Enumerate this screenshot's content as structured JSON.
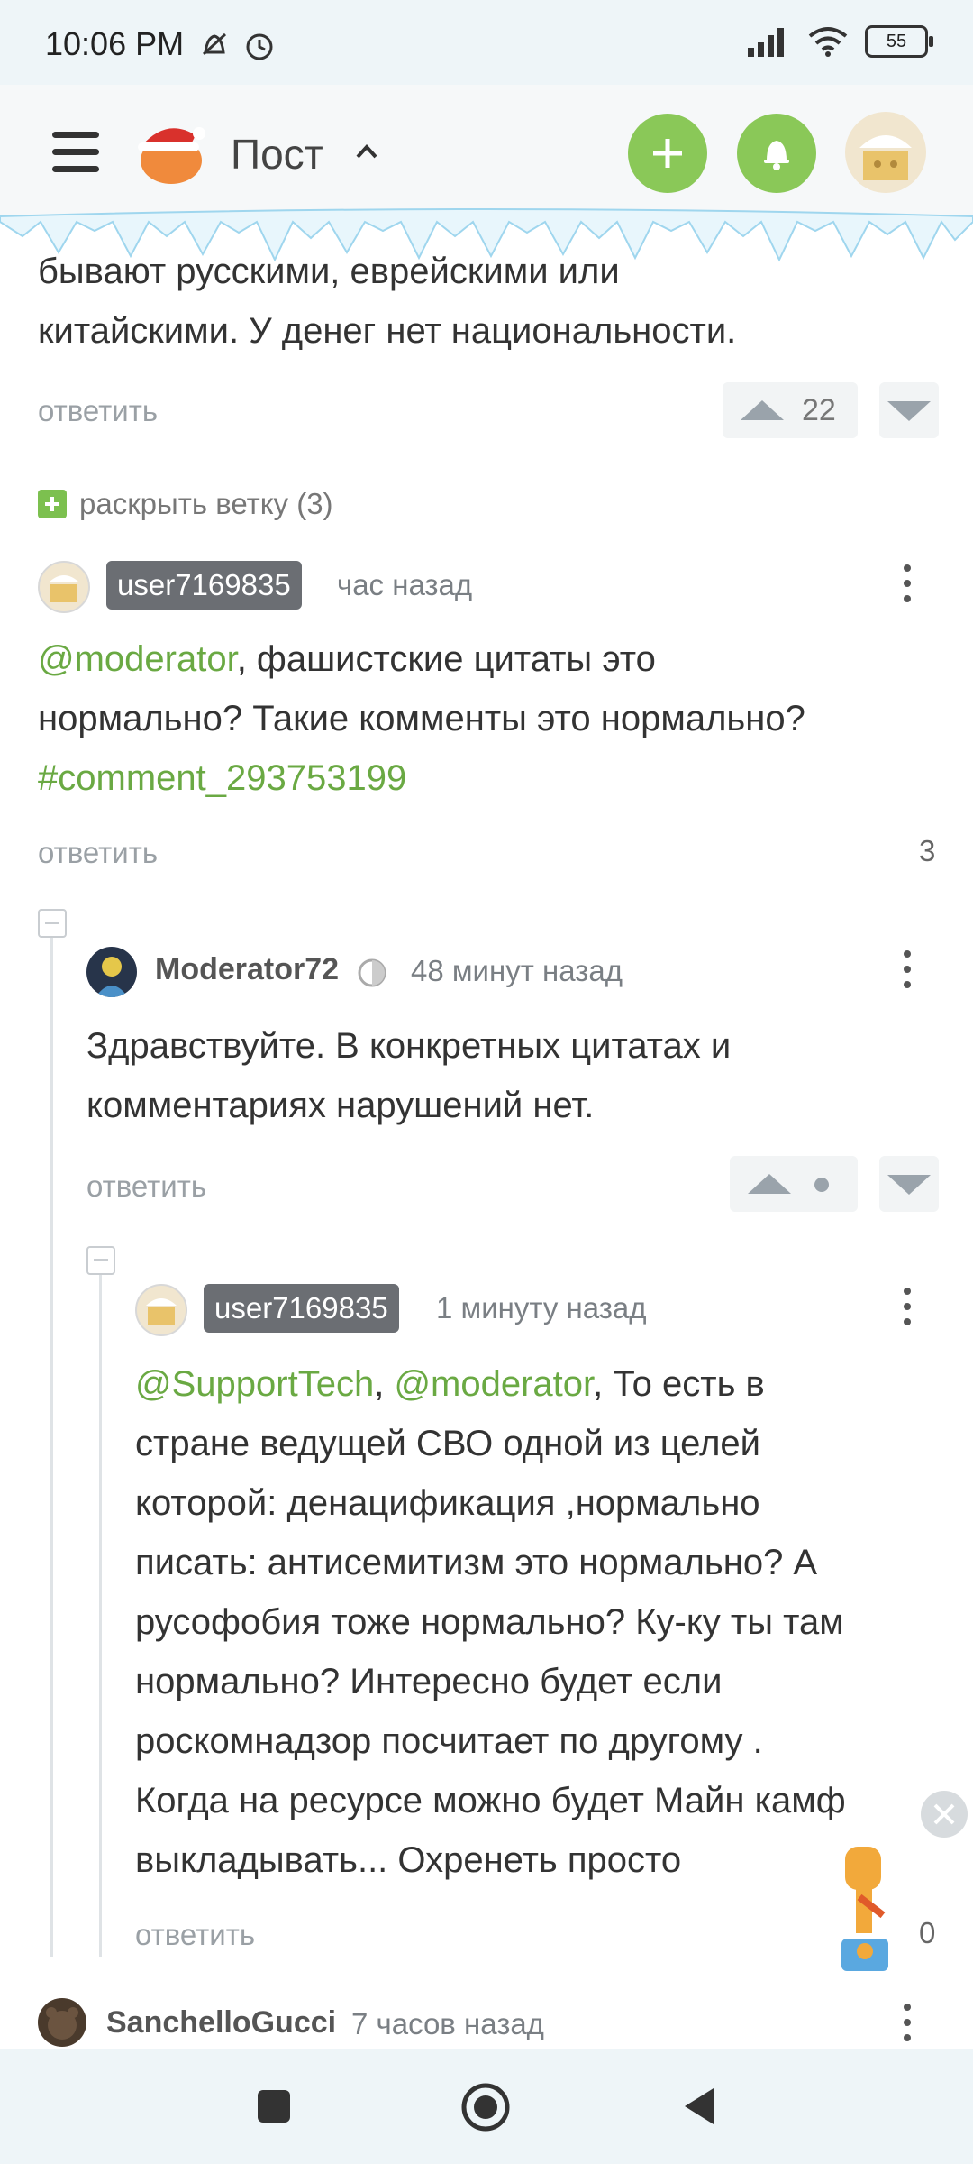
{
  "status_bar": {
    "time": "10:06 PM",
    "battery": "55"
  },
  "header": {
    "title": "Пост"
  },
  "comments": [
    {
      "text_lines": [
        "бывают русскими, еврейскими или",
        "китайскими. У денег нет национальности."
      ],
      "reply_label": "ответить",
      "rating": "22",
      "expand_label": "раскрыть ветку (3)"
    },
    {
      "username": "user7169835",
      "time": "час назад",
      "mention": "@moderator",
      "text_line1_rest": ", фашистские цитаты это",
      "text_line2": "нормально? Такие комменты это нормально?",
      "anchor_link": "#comment_293753199",
      "reply_label": "ответить",
      "replies_count": "3"
    },
    {
      "username": "Moderator72",
      "time": "48 минут назад",
      "text_lines": [
        "Здравствуйте. В конкретных цитатах и",
        "комментариях нарушений нет."
      ],
      "reply_label": "ответить"
    },
    {
      "username": "user7169835",
      "time": "1 минуту назад",
      "mention1": "@SupportTech",
      "separator": ", ",
      "mention2": "@moderator",
      "text_line1_rest": ",  То есть в",
      "text_lines": [
        "стране ведущей СВО одной из целей",
        "которой: денацификация ,нормально",
        "писать: антисемитизм это нормально? А",
        "русофобия тоже нормально? Ку-ку ты там",
        "нормально? Интересно будет если",
        "роскомнадзор посчитает по другому .",
        "Когда на ресурсе можно будет Майн камф",
        "выкладывать... Охренеть просто"
      ],
      "reply_label": "ответить",
      "rating": "0"
    },
    {
      "username": "SanchelloGucci",
      "time": "7 часов назад"
    }
  ],
  "colors": {
    "accent": "#8ac858",
    "link": "#6aa943",
    "badge": "#6b6e73"
  }
}
